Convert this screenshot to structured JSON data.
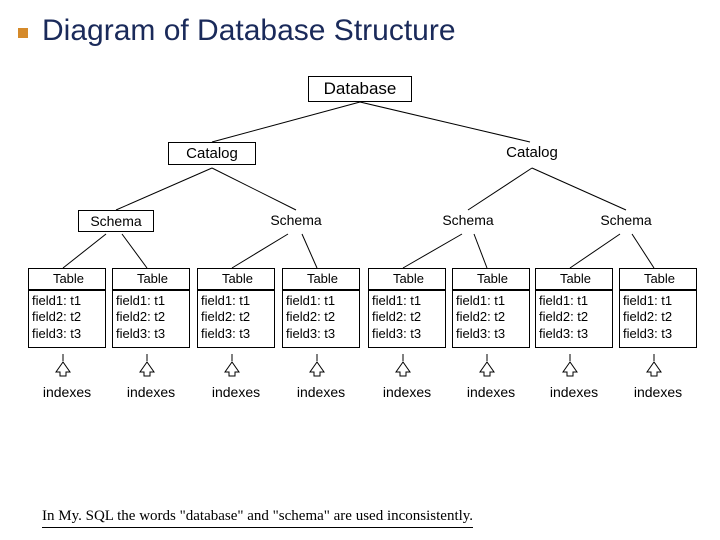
{
  "title": "Diagram of Database Structure",
  "nodes": {
    "database": "Database",
    "catalog_left": "Catalog",
    "catalog_right": "Catalog",
    "schema_1": "Schema",
    "schema_2": "Schema",
    "schema_3": "Schema",
    "schema_4": "Schema"
  },
  "table_header": "Table",
  "table_rows": [
    "field1: t1",
    "field2: t2",
    "field3: t3"
  ],
  "index_label": "indexes",
  "footnote": "In My. SQL the words \"database\" and \"schema\" are used inconsistently."
}
